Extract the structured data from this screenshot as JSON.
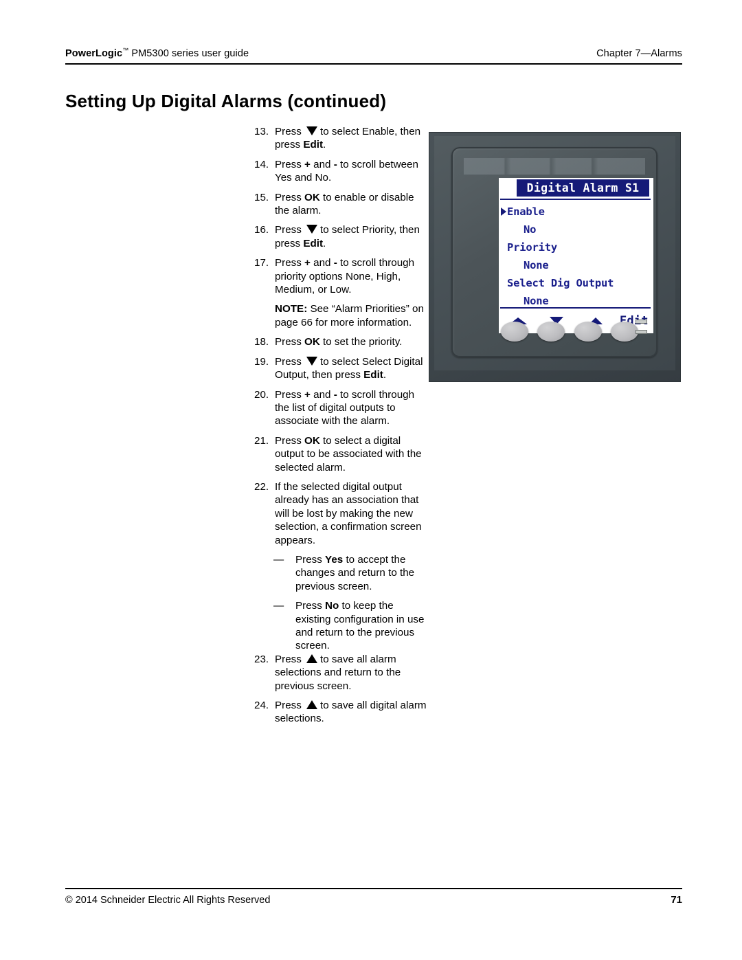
{
  "header": {
    "left_prefix": "PowerLogic",
    "left_tm": "™",
    "left_suffix": " PM5300 series user guide",
    "right": "Chapter 7—Alarms"
  },
  "title": "Setting Up Digital Alarms (continued)",
  "steps": [
    {
      "num": "13.",
      "parts": [
        {
          "t": "text",
          "v": "Press "
        },
        {
          "t": "icon",
          "v": "triangle-down-icon"
        },
        {
          "t": "text",
          "v": "to select Enable, then press "
        },
        {
          "t": "bold",
          "v": "Edit"
        },
        {
          "t": "text",
          "v": "."
        }
      ]
    },
    {
      "num": "14.",
      "parts": [
        {
          "t": "text",
          "v": "Press "
        },
        {
          "t": "bold",
          "v": "+"
        },
        {
          "t": "text",
          "v": " and "
        },
        {
          "t": "bold",
          "v": "-"
        },
        {
          "t": "text",
          "v": " to scroll between Yes and No."
        }
      ]
    },
    {
      "num": "15.",
      "parts": [
        {
          "t": "text",
          "v": "Press "
        },
        {
          "t": "bold",
          "v": "OK"
        },
        {
          "t": "text",
          "v": " to enable or disable the alarm."
        }
      ]
    },
    {
      "num": "16.",
      "parts": [
        {
          "t": "text",
          "v": "Press "
        },
        {
          "t": "icon",
          "v": "triangle-down-icon"
        },
        {
          "t": "text",
          "v": "to select Priority, then press "
        },
        {
          "t": "bold",
          "v": "Edit"
        },
        {
          "t": "text",
          "v": "."
        }
      ]
    },
    {
      "num": "17.",
      "parts": [
        {
          "t": "text",
          "v": "Press "
        },
        {
          "t": "bold",
          "v": "+"
        },
        {
          "t": "text",
          "v": " and "
        },
        {
          "t": "bold",
          "v": "-"
        },
        {
          "t": "text",
          "v": " to scroll through priority options None, High, Medium, or Low."
        }
      ]
    },
    {
      "num": "note",
      "parts": [
        {
          "t": "bold",
          "v": "NOTE:"
        },
        {
          "t": "text",
          "v": " See “Alarm Priorities” on page 66 for more information."
        }
      ]
    },
    {
      "num": "18.",
      "parts": [
        {
          "t": "text",
          "v": "Press "
        },
        {
          "t": "bold",
          "v": "OK"
        },
        {
          "t": "text",
          "v": " to set the priority."
        }
      ]
    },
    {
      "num": "19.",
      "parts": [
        {
          "t": "text",
          "v": "Press "
        },
        {
          "t": "icon",
          "v": "triangle-down-icon"
        },
        {
          "t": "text",
          "v": "to select Select Digital Output, then press "
        },
        {
          "t": "bold",
          "v": "Edit"
        },
        {
          "t": "text",
          "v": "."
        }
      ]
    },
    {
      "num": "20.",
      "parts": [
        {
          "t": "text",
          "v": "Press "
        },
        {
          "t": "bold",
          "v": "+"
        },
        {
          "t": "text",
          "v": " and "
        },
        {
          "t": "bold",
          "v": "-"
        },
        {
          "t": "text",
          "v": " to scroll through the list of digital outputs to associate with the alarm."
        }
      ]
    },
    {
      "num": "21.",
      "parts": [
        {
          "t": "text",
          "v": "Press "
        },
        {
          "t": "bold",
          "v": "OK"
        },
        {
          "t": "text",
          "v": " to select a digital output to be associated with the selected alarm."
        }
      ]
    },
    {
      "num": "22.",
      "parts": [
        {
          "t": "text",
          "v": "If the selected digital output already has an association that will be lost by making the new selection, a confirmation screen appears."
        }
      ]
    },
    {
      "num": "dash",
      "dash": "—",
      "parts": [
        {
          "t": "text",
          "v": "Press "
        },
        {
          "t": "bold",
          "v": "Yes"
        },
        {
          "t": "text",
          "v": " to accept the changes and return to the previous screen."
        }
      ]
    },
    {
      "num": "dash",
      "dash": "—",
      "parts": [
        {
          "t": "text",
          "v": "Press "
        },
        {
          "t": "bold",
          "v": "No"
        },
        {
          "t": "text",
          "v": " to keep the existing configuration in use and return to the previous screen."
        }
      ]
    },
    {
      "num": "23.",
      "parts": [
        {
          "t": "text",
          "v": "Press "
        },
        {
          "t": "icon",
          "v": "triangle-up-icon"
        },
        {
          "t": "text",
          "v": "to save all alarm selections and return to the previous screen."
        }
      ]
    },
    {
      "num": "24.",
      "parts": [
        {
          "t": "text",
          "v": "Press "
        },
        {
          "t": "icon",
          "v": "triangle-up-icon"
        },
        {
          "t": "text",
          "v": "to save all digital alarm selections."
        }
      ]
    }
  ],
  "device": {
    "lcd": {
      "title": "Digital Alarm S1",
      "rows": [
        {
          "label": "Enable",
          "selected": true,
          "is_value": false
        },
        {
          "label": "No",
          "selected": false,
          "is_value": true
        },
        {
          "label": "Priority",
          "selected": false,
          "is_value": false
        },
        {
          "label": "None",
          "selected": false,
          "is_value": true
        },
        {
          "label": "Select Dig Output",
          "selected": false,
          "is_value": false
        },
        {
          "label": "None",
          "selected": false,
          "is_value": true
        }
      ],
      "softkeys": [
        {
          "icon": "triangle-up-wide-icon",
          "label": ""
        },
        {
          "icon": "triangle-down-icon",
          "label": ""
        },
        {
          "icon": "triangle-up-icon",
          "label": ""
        },
        {
          "icon": "",
          "label": "Edit"
        }
      ],
      "title_bg": "#151a78",
      "text_color": "#1a1f8c"
    },
    "buttons": [
      "button-1",
      "button-2",
      "button-3",
      "button-4"
    ],
    "leds": [
      "led-indicator-1",
      "led-indicator-2"
    ]
  },
  "footer": {
    "copyright": "© 2014 Schneider Electric All Rights Reserved",
    "page_number": "71"
  }
}
